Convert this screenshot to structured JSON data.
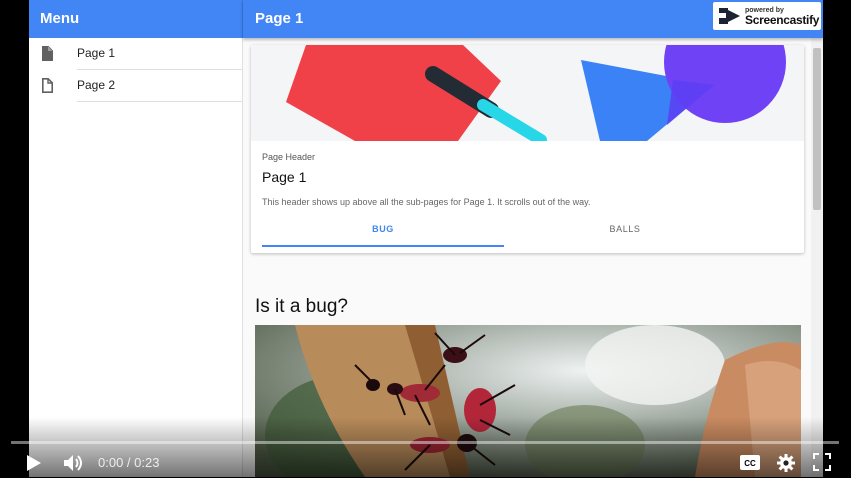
{
  "sidebar": {
    "title": "Menu",
    "items": [
      {
        "label": "Page 1",
        "icon": "file-filled-icon"
      },
      {
        "label": "Page 2",
        "icon": "file-outline-icon"
      }
    ]
  },
  "header": {
    "title": "Page 1",
    "watermark_small": "powered by",
    "watermark_big": "Screencastify"
  },
  "card": {
    "eyebrow": "Page Header",
    "title": "Page 1",
    "description": "This header shows up above all the sub-pages for Page 1. It scrolls out of the way.",
    "tabs": [
      {
        "label": "BUG",
        "active": true
      },
      {
        "label": "BALLS",
        "active": false
      }
    ]
  },
  "section": {
    "title": "Is it a bug?"
  },
  "player": {
    "time": "0:00 / 0:23",
    "progress": 0
  },
  "colors": {
    "primary": "#4285f4",
    "red": "#ef4147",
    "cyan": "#27d7e8",
    "blue": "#3b82f6",
    "purple": "#7042f5"
  }
}
